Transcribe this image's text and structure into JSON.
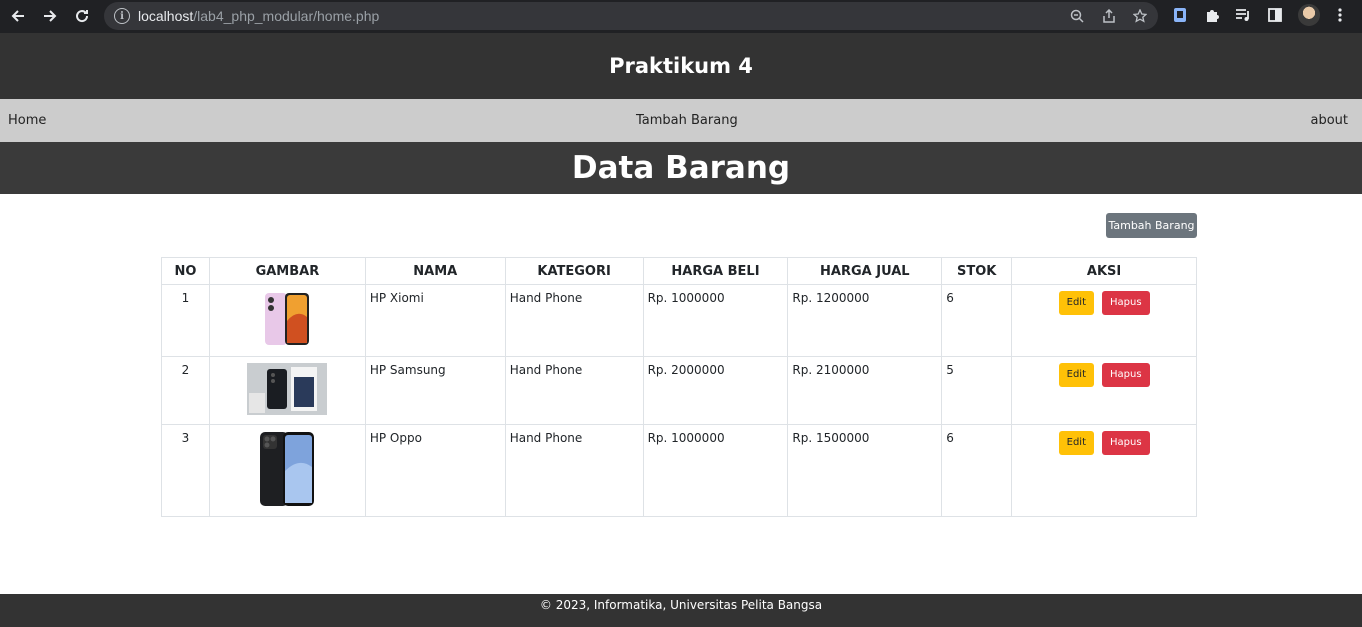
{
  "browser": {
    "url_host": "localhost",
    "url_path": "/lab4_php_modular/home.php"
  },
  "header": {
    "title": "Praktikum 4"
  },
  "nav": {
    "home": "Home",
    "tambah": "Tambah Barang",
    "about": "about"
  },
  "page": {
    "title": "Data Barang",
    "add_button": "Tambah Barang"
  },
  "table": {
    "columns": [
      "NO",
      "GAMBAR",
      "NAMA",
      "KATEGORI",
      "HARGA BELI",
      "HARGA JUAL",
      "STOK",
      "AKSI"
    ],
    "rows": [
      {
        "no": "1",
        "nama": "HP Xiomi",
        "kategori": "Hand Phone",
        "harga_beli": "Rp. 1000000",
        "harga_jual": "Rp. 1200000",
        "stok": "6",
        "edit": "Edit",
        "hapus": "Hapus"
      },
      {
        "no": "2",
        "nama": "HP Samsung",
        "kategori": "Hand Phone",
        "harga_beli": "Rp. 2000000",
        "harga_jual": "Rp. 2100000",
        "stok": "5",
        "edit": "Edit",
        "hapus": "Hapus"
      },
      {
        "no": "3",
        "nama": "HP Oppo",
        "kategori": "Hand Phone",
        "harga_beli": "Rp. 1000000",
        "harga_jual": "Rp. 1500000",
        "stok": "6",
        "edit": "Edit",
        "hapus": "Hapus"
      }
    ]
  },
  "footer": {
    "text": "© 2023, Informatika, Universitas Pelita Bangsa"
  },
  "colors": {
    "header_bg": "#333333",
    "nav_bg": "#cccccc",
    "edit_btn": "#ffc107",
    "hapus_btn": "#dc3545",
    "tambah_btn": "#6c757d"
  }
}
